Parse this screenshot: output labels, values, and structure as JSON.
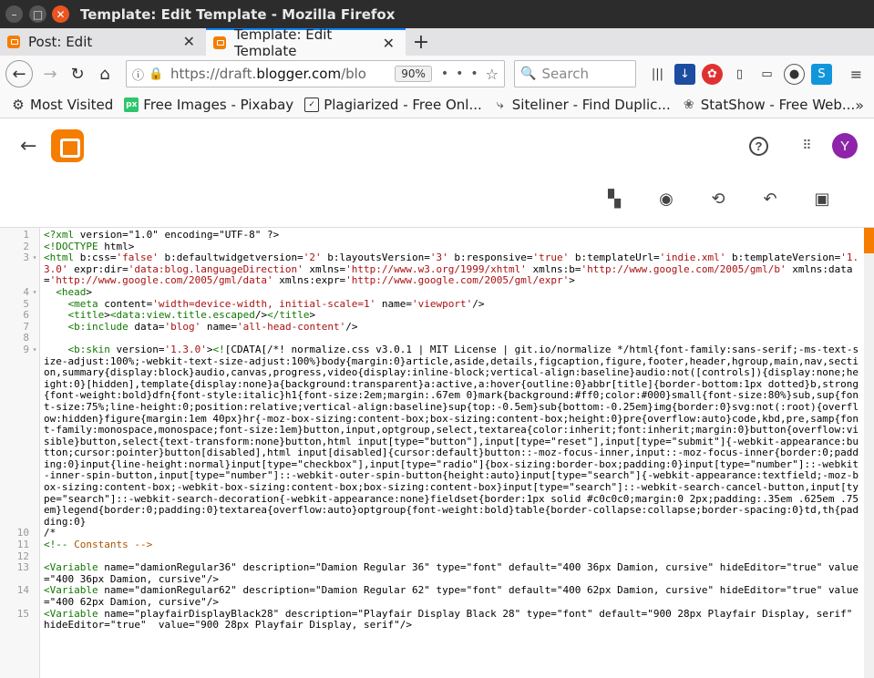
{
  "window": {
    "title": "Template: Edit Template - Mozilla Firefox"
  },
  "tabs": [
    {
      "label": "Post: Edit"
    },
    {
      "label": "Template: Edit Template"
    }
  ],
  "nav": {
    "url_prefix": "https://draft.",
    "url_domain": "blogger.com",
    "url_suffix": "/blo",
    "zoom": "90%",
    "search_placeholder": "Search"
  },
  "bookmarks": [
    {
      "label": "Most Visited",
      "icon": "gear-icon"
    },
    {
      "label": "Free Images - Pixabay",
      "icon": "pixabay-icon"
    },
    {
      "label": "Plagiarized - Free Onl...",
      "icon": "plagiarized-icon"
    },
    {
      "label": "Siteliner - Find Duplic...",
      "icon": "siteliner-icon"
    },
    {
      "label": "StatShow - Free Web...",
      "icon": "statshow-icon"
    }
  ],
  "header": {
    "avatar_letter": "Y"
  },
  "editor": {
    "lines": [
      {
        "n": "1",
        "fold": "",
        "text": "<?xml version=\"1.0\" encoding=\"UTF-8\" ?>"
      },
      {
        "n": "2",
        "fold": "",
        "text": "<!DOCTYPE html>"
      },
      {
        "n": "3",
        "fold": "▾",
        "text": "<html b:css='false' b:defaultwidgetversion='2' b:layoutsVersion='3' b:responsive='true' b:templateUrl='indie.xml' b:templateVersion='1.3.0' expr:dir='data:blog.languageDirection' xmlns='http://www.w3.org/1999/xhtml' xmlns:b='http://www.google.com/2005/gml/b' xmlns:data='http://www.google.com/2005/gml/data' xmlns:expr='http://www.google.com/2005/gml/expr'>"
      },
      {
        "n": "4",
        "fold": "▾",
        "text": "  <head>"
      },
      {
        "n": "5",
        "fold": "",
        "text": "    <meta content='width=device-width, initial-scale=1' name='viewport'/>"
      },
      {
        "n": "6",
        "fold": "",
        "text": "    <title><data:view.title.escaped/></title>"
      },
      {
        "n": "7",
        "fold": "",
        "text": "    <b:include data='blog' name='all-head-content'/>"
      },
      {
        "n": "8",
        "fold": "",
        "text": ""
      },
      {
        "n": "9",
        "fold": "▾",
        "text": "    <b:skin version='1.3.0'><![CDATA[/*! normalize.css v3.0.1 | MIT License | git.io/normalize */html{font-family:sans-serif;-ms-text-size-adjust:100%;-webkit-text-size-adjust:100%}body{margin:0}article,aside,details,figcaption,figure,footer,header,hgroup,main,nav,section,summary{display:block}audio,canvas,progress,video{display:inline-block;vertical-align:baseline}audio:not([controls]){display:none;height:0}[hidden],template{display:none}a{background:transparent}a:active,a:hover{outline:0}abbr[title]{border-bottom:1px dotted}b,strong{font-weight:bold}dfn{font-style:italic}h1{font-size:2em;margin:.67em 0}mark{background:#ff0;color:#000}small{font-size:80%}sub,sup{font-size:75%;line-height:0;position:relative;vertical-align:baseline}sup{top:-0.5em}sub{bottom:-0.25em}img{border:0}svg:not(:root){overflow:hidden}figure{margin:1em 40px}hr{-moz-box-sizing:content-box;box-sizing:content-box;height:0}pre{overflow:auto}code,kbd,pre,samp{font-family:monospace,monospace;font-size:1em}button,input,optgroup,select,textarea{color:inherit;font:inherit;margin:0}button{overflow:visible}button,select{text-transform:none}button,html input[type=\"button\"],input[type=\"reset\"],input[type=\"submit\"]{-webkit-appearance:button;cursor:pointer}button[disabled],html input[disabled]{cursor:default}button::-moz-focus-inner,input::-moz-focus-inner{border:0;padding:0}input{line-height:normal}input[type=\"checkbox\"],input[type=\"radio\"]{box-sizing:border-box;padding:0}input[type=\"number\"]::-webkit-inner-spin-button,input[type=\"number\"]::-webkit-outer-spin-button{height:auto}input[type=\"search\"]{-webkit-appearance:textfield;-moz-box-sizing:content-box;-webkit-box-sizing:content-box;box-sizing:content-box}input[type=\"search\"]::-webkit-search-cancel-button,input[type=\"search\"]::-webkit-search-decoration{-webkit-appearance:none}fieldset{border:1px solid #c0c0c0;margin:0 2px;padding:.35em .625em .75em}legend{border:0;padding:0}textarea{overflow:auto}optgroup{font-weight:bold}table{border-collapse:collapse;border-spacing:0}td,th{padding:0}"
      },
      {
        "n": "10",
        "fold": "",
        "text": "/*"
      },
      {
        "n": "11",
        "fold": "",
        "text": "<!-- Constants -->"
      },
      {
        "n": "12",
        "fold": "",
        "text": ""
      },
      {
        "n": "13",
        "fold": "",
        "text": "<Variable name=\"damionRegular36\" description=\"Damion Regular 36\" type=\"font\" default=\"400 36px Damion, cursive\" hideEditor=\"true\" value=\"400 36px Damion, cursive\"/>"
      },
      {
        "n": "14",
        "fold": "",
        "text": "<Variable name=\"damionRegular62\" description=\"Damion Regular 62\" type=\"font\" default=\"400 62px Damion, cursive\" hideEditor=\"true\" value=\"400 62px Damion, cursive\"/>"
      },
      {
        "n": "15",
        "fold": "",
        "text": "<Variable name=\"playfairDisplayBlack28\" description=\"Playfair Display Black 28\" type=\"font\" default=\"900 28px Playfair Display, serif\" hideEditor=\"true\"  value=\"900 28px Playfair Display, serif\"/>"
      }
    ]
  }
}
